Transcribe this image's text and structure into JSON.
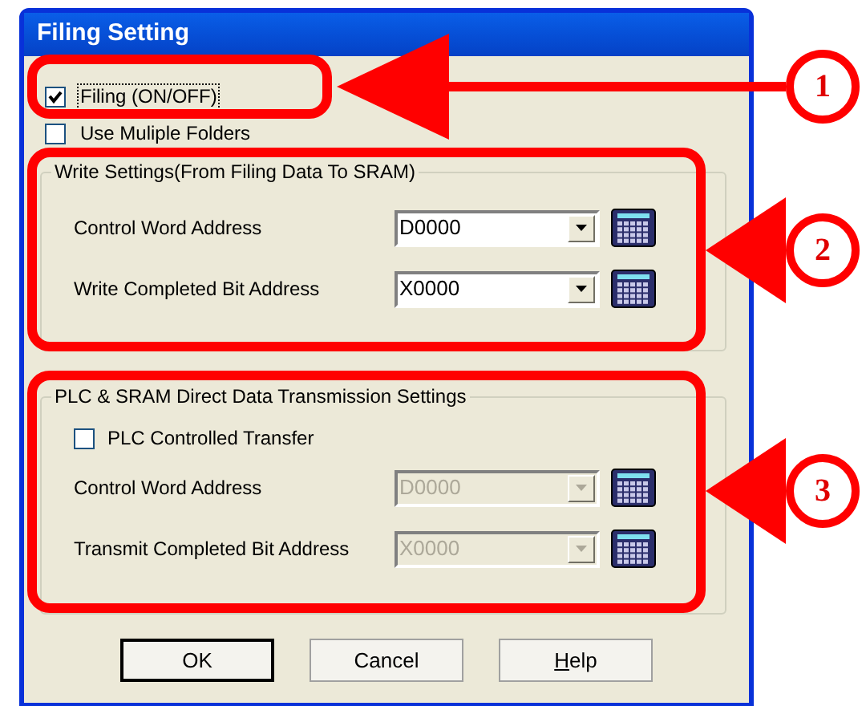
{
  "window": {
    "title": "Filing Setting"
  },
  "options": [
    {
      "label": "Filing (ON/OFF)",
      "checked": true,
      "focused": true
    },
    {
      "label": "Use Muliple Folders",
      "checked": false,
      "focused": false
    }
  ],
  "groups": [
    {
      "title": "Write Settings(From Filing Data To SRAM)",
      "rows": [
        {
          "kind": "combo",
          "label": "Control Word Address",
          "value": "D0000",
          "disabled": false
        },
        {
          "kind": "combo",
          "label": "Write Completed Bit Address",
          "value": "X0000",
          "disabled": false
        }
      ]
    },
    {
      "title": "PLC & SRAM Direct Data Transmission Settings",
      "rows": [
        {
          "kind": "checkbox",
          "label": "PLC Controlled Transfer",
          "checked": false
        },
        {
          "kind": "combo",
          "label": "Control Word Address",
          "value": "D0000",
          "disabled": true
        },
        {
          "kind": "combo",
          "label": "Transmit Completed Bit Address",
          "value": "X0000",
          "disabled": true
        }
      ]
    }
  ],
  "buttons": [
    {
      "label": "OK",
      "default": true,
      "mnemonic": false
    },
    {
      "label": "Cancel",
      "default": false,
      "mnemonic": false
    },
    {
      "label": "Help",
      "default": false,
      "mnemonic": true
    }
  ],
  "callouts": [
    {
      "number": "1"
    },
    {
      "number": "2"
    },
    {
      "number": "3"
    }
  ]
}
